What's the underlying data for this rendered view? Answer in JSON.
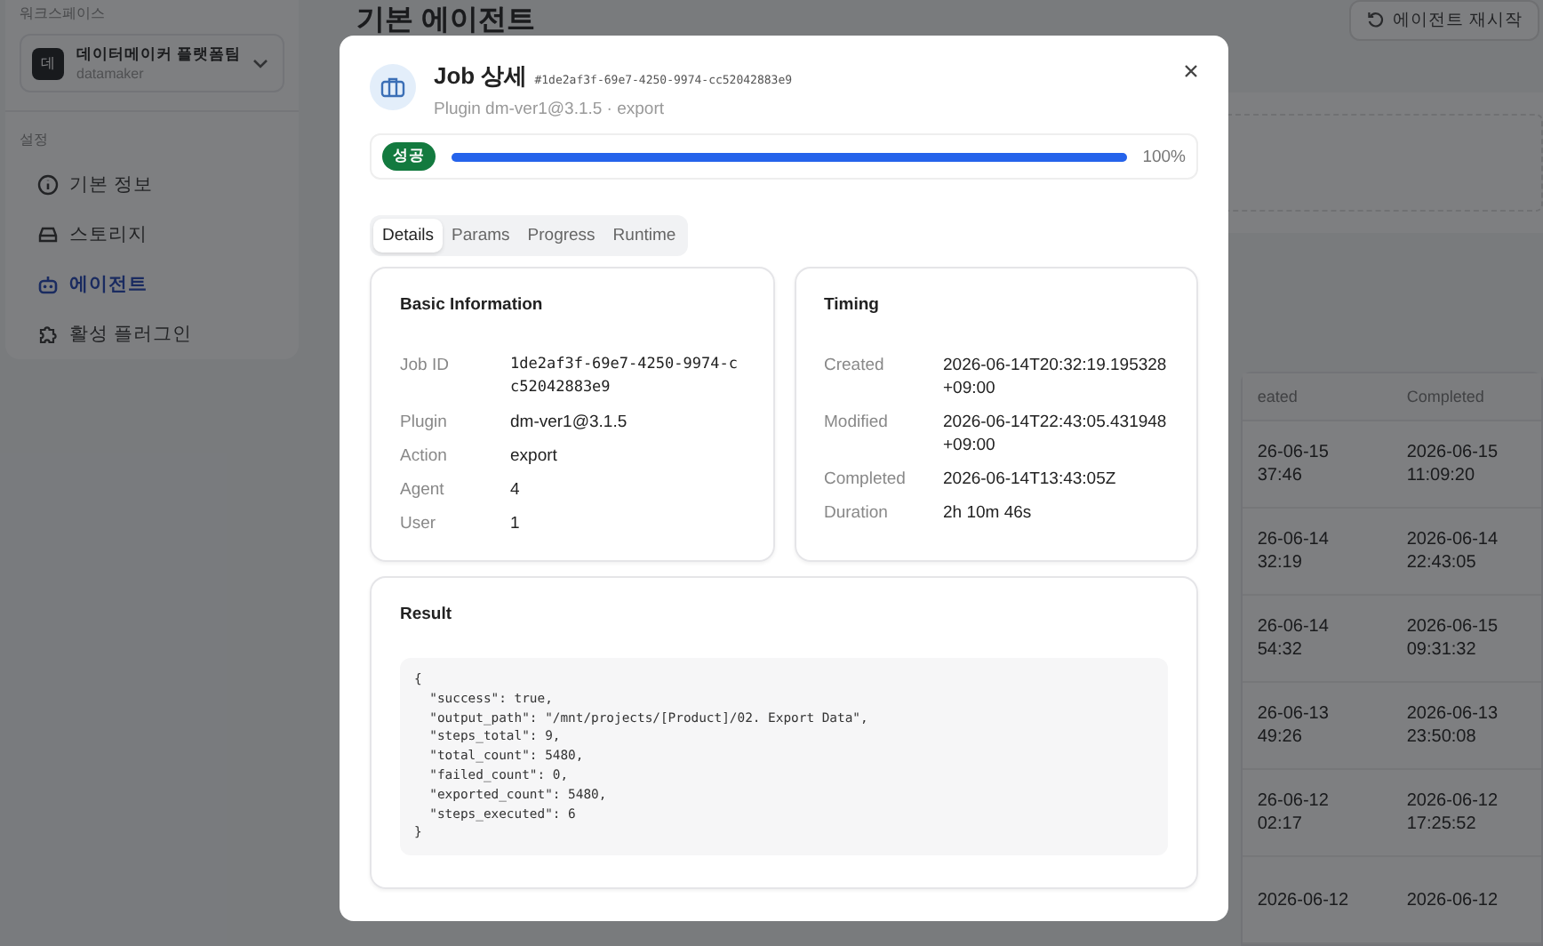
{
  "sidebar": {
    "section_label": "워크스페이스",
    "workspace": {
      "avatar": "데",
      "name": "데이터메이커 플랫폼팀",
      "slug": "datamaker"
    },
    "settings_label": "설정",
    "items": [
      {
        "label": "기본 정보",
        "selected": false
      },
      {
        "label": "스토리지",
        "selected": false
      },
      {
        "label": "에이전트",
        "selected": true
      },
      {
        "label": "활성 플러그인",
        "selected": false
      }
    ]
  },
  "page": {
    "title": "기본 에이전트",
    "restart_button": "에이전트 재시작",
    "table": {
      "columns": [
        "eated",
        "Completed"
      ],
      "rows": [
        {
          "created": [
            "26-06-15",
            "37:46"
          ],
          "completed": [
            "2026-06-15",
            "11:09:20"
          ]
        },
        {
          "created": [
            "26-06-14",
            "32:19"
          ],
          "completed": [
            "2026-06-14",
            "22:43:05"
          ]
        },
        {
          "created": [
            "26-06-14",
            "54:32"
          ],
          "completed": [
            "2026-06-15",
            "09:31:32"
          ]
        },
        {
          "created": [
            "26-06-13",
            "49:26"
          ],
          "completed": [
            "2026-06-13",
            "23:50:08"
          ]
        },
        {
          "created": [
            "26-06-12",
            "02:17"
          ],
          "completed": [
            "2026-06-12",
            "17:25:52"
          ]
        },
        {
          "created": [
            "2026-06-12"
          ],
          "completed": [
            "2026-06-12"
          ]
        }
      ]
    }
  },
  "dialog": {
    "title": "Job 상세",
    "job_hash": "#1de2af3f-69e7-4250-9974-cc52042883e9",
    "subtitle": "Plugin dm-ver1@3.1.5 · export",
    "status": {
      "badge": "성공",
      "level": 1.0,
      "reading": "100%"
    },
    "tabs": [
      {
        "label": "Details",
        "selected": true
      },
      {
        "label": "Params",
        "selected": false
      },
      {
        "label": "Progress",
        "selected": false
      },
      {
        "label": "Runtime",
        "selected": false
      }
    ],
    "cards": [
      {
        "title": "Basic Information",
        "fields": [
          {
            "label": "Job ID",
            "value": "1de2af3f-69e7-4250-9974-cc52042883e9",
            "kind": "mono"
          },
          {
            "label": "Plugin",
            "value": "dm-ver1@3.1.5",
            "kind": "text"
          },
          {
            "label": "Action",
            "value": "export",
            "kind": "text"
          },
          {
            "label": "Agent",
            "value": "4",
            "kind": "text"
          },
          {
            "label": "User",
            "value": "1",
            "kind": "text"
          }
        ]
      },
      {
        "title": "Timing",
        "fields": [
          {
            "label": "Created",
            "value": "2026-06-14T20:32:19.195328+09:00",
            "kind": "text"
          },
          {
            "label": "Modified",
            "value": "2026-06-14T22:43:05.431948+09:00",
            "kind": "text"
          },
          {
            "label": "Completed",
            "value": "2026-06-14T13:43:05Z",
            "kind": "text"
          },
          {
            "label": "Duration",
            "value": "2h 10m 46s",
            "kind": "text"
          }
        ]
      }
    ],
    "result": {
      "title": "Result",
      "code": "{\n  \"success\": true,\n  \"output_path\": \"/mnt/projects/[Product]/02. Export Data\",\n  \"steps_total\": 9,\n  \"total_count\": 5480,\n  \"failed_count\": 0,\n  \"exported_count\": 5480,\n  \"steps_executed\": 6\n}"
    }
  }
}
